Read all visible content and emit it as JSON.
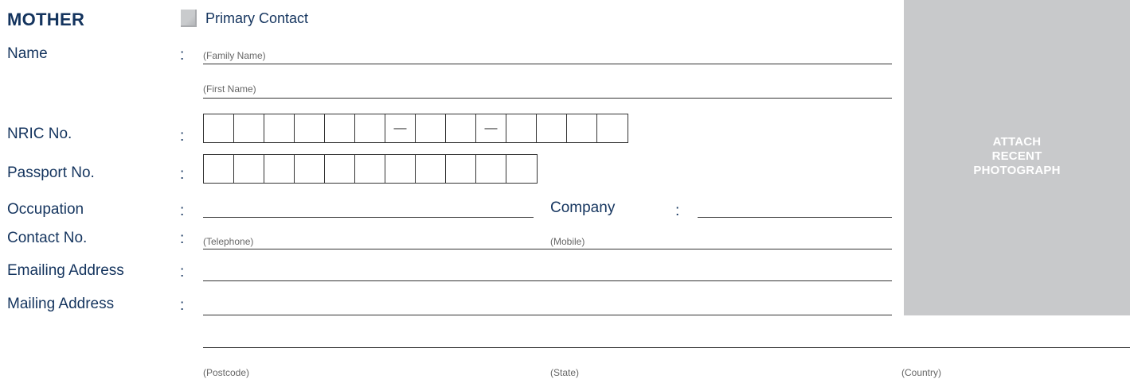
{
  "section": {
    "title": "MOTHER",
    "primary_contact_label": "Primary Contact",
    "primary_contact_checked": false
  },
  "fields": {
    "name_label": "Name",
    "family_name_hint": "(Family Name)",
    "first_name_hint": "(First Name)",
    "nric_label": "NRIC No.",
    "nric_separator": "—",
    "passport_label": "Passport No.",
    "occupation_label": "Occupation",
    "company_label": "Company",
    "contact_label": "Contact No.",
    "telephone_hint": "(Telephone)",
    "mobile_hint": "(Mobile)",
    "email_label": "Emailing Address",
    "mailing_label": "Mailing Address",
    "postcode_hint": "(Postcode)",
    "state_hint": "(State)",
    "country_hint": "(Country)",
    "colon": ":"
  },
  "photo": {
    "line1": "ATTACH",
    "line2": "RECENT",
    "line3": "PHOTOGRAPH"
  },
  "colors": {
    "label_text": "#14345e",
    "photo_box": "#c8c9cb",
    "rule_line": "#333333"
  }
}
